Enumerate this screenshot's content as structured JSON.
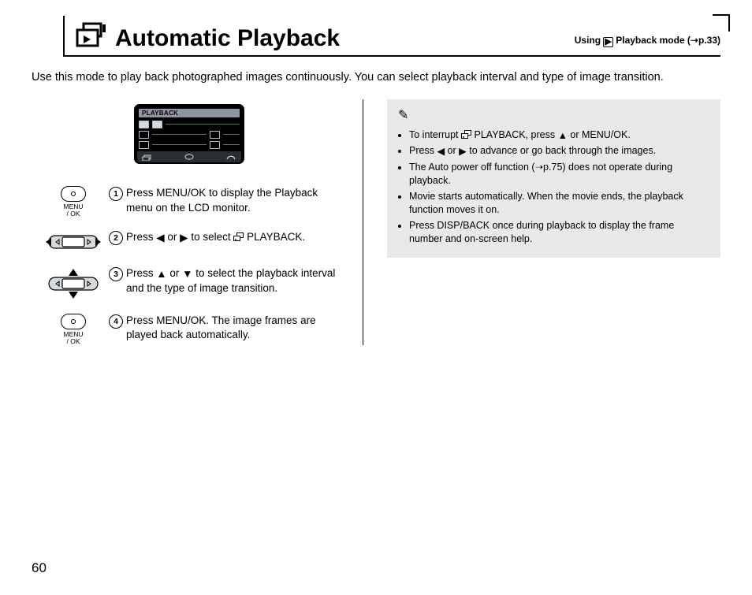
{
  "page_number": "60",
  "title": "Automatic Playback",
  "header_right_pre": "Using ",
  "header_right_post": " Playback mode (➝p.33)",
  "intro": "Use this mode to play back photographed images continuously. You can select playback interval and type of image transition.",
  "lcd_label": "PLAYBACK",
  "steps": [
    {
      "num": "1",
      "text": "Press MENU/OK to display the Playback menu on the LCD monitor."
    },
    {
      "num": "2",
      "text_a": "Press ",
      "text_b": " or ",
      "text_c": " to select ",
      "text_d": " PLAYBACK."
    },
    {
      "num": "3",
      "text_a": "Press ",
      "text_b": " or ",
      "text_c": " to select the playback interval and the type of image transition."
    },
    {
      "num": "4",
      "text": "Press MENU/OK. The image frames are played back automatically."
    }
  ],
  "menu_label_1": "MENU",
  "menu_label_2": "/ OK",
  "notes": [
    {
      "a": "To interrupt ",
      "b": " PLAYBACK, press ",
      "c": " or MENU/OK."
    },
    {
      "a": "Press ",
      "b": " or ",
      "c": " to advance or go back through the images."
    },
    {
      "a": "The Auto power off function (➝p.75) does not operate during playback."
    },
    {
      "a": "Movie starts automatically. When the movie ends, the playback function moves it on."
    },
    {
      "a": "Press DISP/BACK once during playback to display the frame number and on-screen help."
    }
  ]
}
